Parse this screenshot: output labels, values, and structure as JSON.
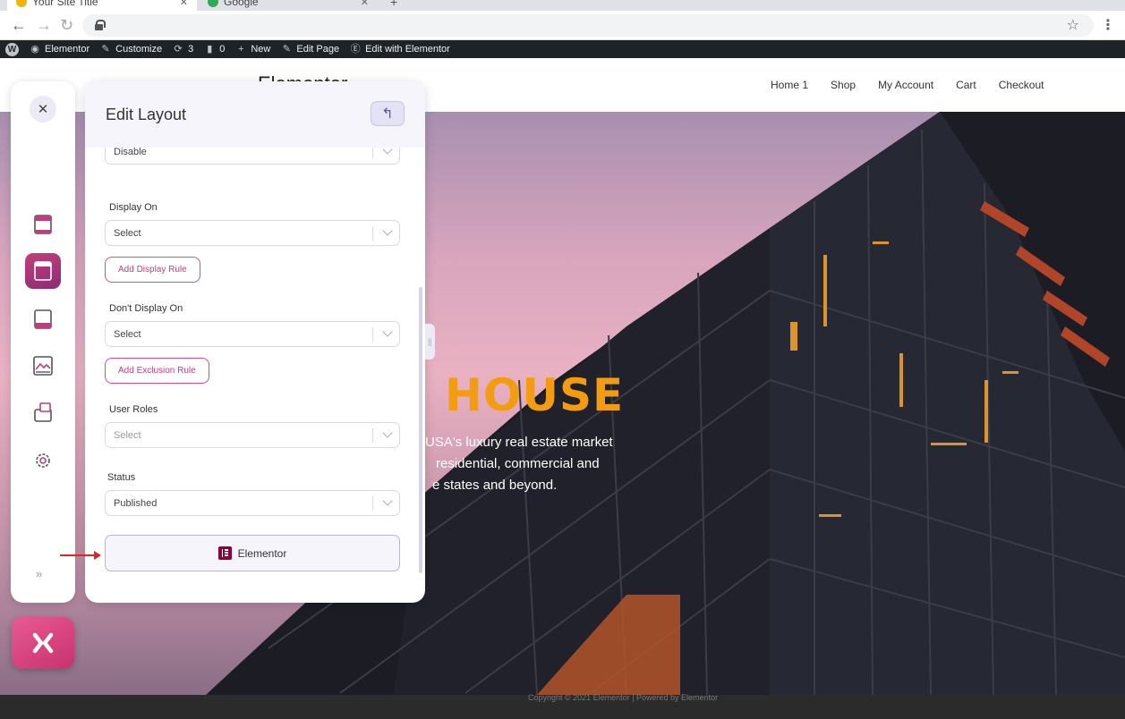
{
  "browser": {
    "tabs": [
      {
        "title": "Your Site Title",
        "active": true
      },
      {
        "title": "Google",
        "active": false
      }
    ]
  },
  "admin_bar": {
    "items": [
      {
        "label": "Elementor",
        "icon": "dashboard-icon"
      },
      {
        "label": "Customize",
        "icon": "brush-icon"
      },
      {
        "label": "3",
        "icon": "updates-icon"
      },
      {
        "label": "0",
        "icon": "comment-icon"
      },
      {
        "label": "New",
        "icon": "plus-icon"
      },
      {
        "label": "Edit Page",
        "icon": "pencil-icon"
      },
      {
        "label": "Edit with Elementor",
        "icon": "elementor-icon"
      }
    ]
  },
  "site": {
    "logo_text": "Elementor",
    "nav": [
      "Home 1",
      "Shop",
      "My Account",
      "Cart",
      "Checkout"
    ],
    "hero_title": "HOUSE",
    "hero_lines": [
      "USA's luxury real estate market",
      "residential, commercial and",
      "e states and beyond."
    ]
  },
  "rail": {
    "icons": [
      "header-layout-icon",
      "page-layout-icon",
      "footer-layout-icon",
      "archive-layout-icon",
      "popup-layout-icon",
      "settings-icon"
    ],
    "active_index": 1
  },
  "panel": {
    "title": "Edit Layout",
    "top_select_value": "Disable",
    "display_on": {
      "label": "Display On",
      "value": "Select"
    },
    "add_display_rule": "Add Display Rule",
    "dont_display_on": {
      "label": "Don't Display On",
      "value": "Select"
    },
    "add_exclusion_rule": "Add Exclusion Rule",
    "user_roles": {
      "label": "User Roles",
      "placeholder": "Select"
    },
    "status": {
      "label": "Status",
      "value": "Published"
    },
    "elementor_button": "Elementor"
  },
  "footer": {
    "copyright": "Copyright © 2021 Elementor | Powered by Elementor"
  },
  "colors": {
    "accent_pink": "#c23c80",
    "active_rail": "#a8337a",
    "hero_title": "#f39c12",
    "fab": "#d94180"
  }
}
